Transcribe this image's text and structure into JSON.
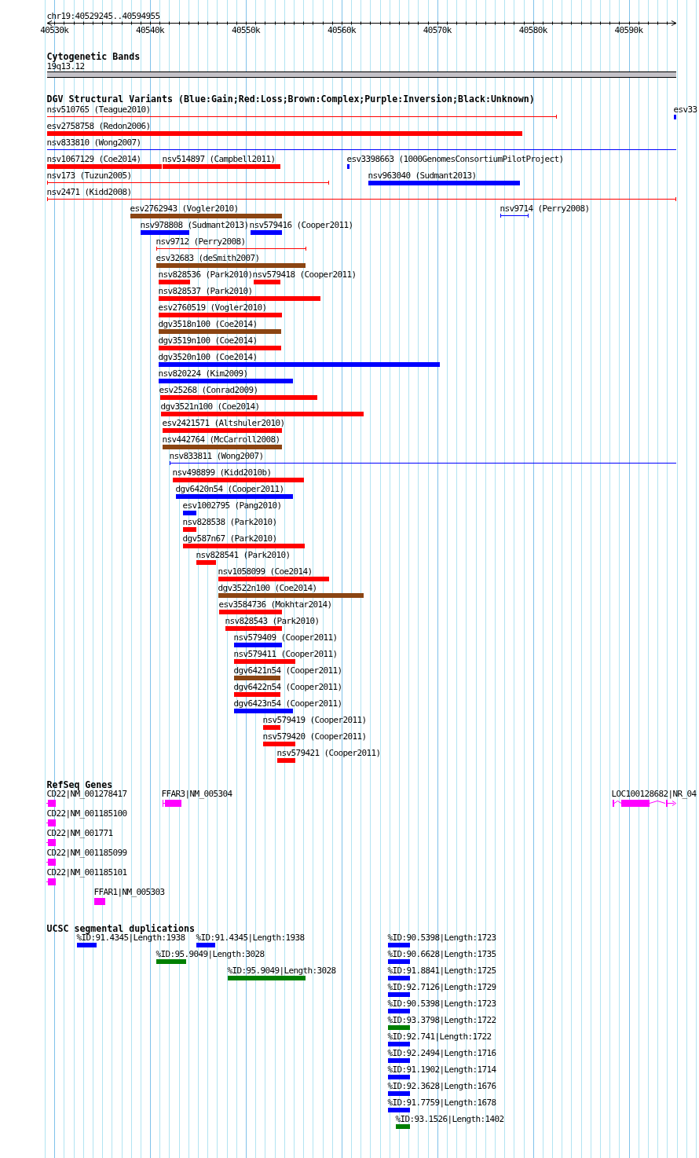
{
  "ruler": {
    "position": "chr19:40529245..40594955",
    "ticks": [
      "40530k",
      "40540k",
      "40550k",
      "40560k",
      "40570k",
      "40580k",
      "40590k"
    ]
  },
  "cytogenetic_bands": {
    "title": "Cytogenetic Bands",
    "band": "19q13.12"
  },
  "dgv_structural_variants": {
    "title": "DGV Structural Variants (Blue:Gain;Red:Loss;Brown:Complex;Purple:Inversion;Black:Unknown)",
    "items": [
      {
        "label": "nsv510765 (Teague2010)",
        "kind": "line",
        "color": "#ff0000"
      },
      {
        "label": "esv33",
        "kind": "bar",
        "color": "#0000ff"
      },
      {
        "label": "esv2758758 (Redon2006)",
        "kind": "bar",
        "color": "#ff0000"
      },
      {
        "label": "nsv833810 (Wong2007)",
        "kind": "line",
        "color": "#0000ff"
      },
      {
        "label": "nsv1067129 (Coe2014)",
        "kind": "bar",
        "color": "#ff0000"
      },
      {
        "label": "nsv514897 (Campbell2011)",
        "kind": "bar",
        "color": "#ff0000"
      },
      {
        "label": "esv3398663 (1000GenomesConsortiumPilotProject)",
        "kind": "bar",
        "color": "#0000ff"
      },
      {
        "label": "nsv173 (Tuzun2005)",
        "kind": "line",
        "color": "#ff0000"
      },
      {
        "label": "nsv963040 (Sudmant2013)",
        "kind": "bar",
        "color": "#0000ff"
      },
      {
        "label": "nsv2471 (Kidd2008)",
        "kind": "line",
        "color": "#ff0000"
      },
      {
        "label": "esv2762943 (Vogler2010)",
        "kind": "bar",
        "color": "#8b4513"
      },
      {
        "label": "nsv9714 (Perry2008)",
        "kind": "line",
        "color": "#0000ff"
      },
      {
        "label": "nsv978808 (Sudmant2013)",
        "kind": "bar",
        "color": "#0000ff"
      },
      {
        "label": "nsv579416 (Cooper2011)",
        "kind": "bar",
        "color": "#0000ff"
      },
      {
        "label": "nsv9712 (Perry2008)",
        "kind": "line",
        "color": "#ff0000"
      },
      {
        "label": "esv32683 (deSmith2007)",
        "kind": "bar",
        "color": "#8b4513"
      },
      {
        "label": "nsv828536 (Park2010)",
        "kind": "bar",
        "color": "#ff0000"
      },
      {
        "label": "nsv579418 (Cooper2011)",
        "kind": "bar",
        "color": "#ff0000"
      },
      {
        "label": "nsv828537 (Park2010)",
        "kind": "bar",
        "color": "#ff0000"
      },
      {
        "label": "esv2760519 (Vogler2010)",
        "kind": "bar",
        "color": "#ff0000"
      },
      {
        "label": "dgv3518n100 (Coe2014)",
        "kind": "bar",
        "color": "#8b4513"
      },
      {
        "label": "dgv3519n100 (Coe2014)",
        "kind": "bar",
        "color": "#ff0000"
      },
      {
        "label": "dgv3520n100 (Coe2014)",
        "kind": "bar",
        "color": "#0000ff"
      },
      {
        "label": "nsv820224 (Kim2009)",
        "kind": "bar",
        "color": "#0000ff"
      },
      {
        "label": "esv25268 (Conrad2009)",
        "kind": "bar",
        "color": "#ff0000"
      },
      {
        "label": "dgv3521n100 (Coe2014)",
        "kind": "bar",
        "color": "#ff0000"
      },
      {
        "label": "esv2421571 (Altshuler2010)",
        "kind": "bar",
        "color": "#ff0000"
      },
      {
        "label": "nsv442764 (McCarroll2008)",
        "kind": "bar",
        "color": "#8b4513"
      },
      {
        "label": "nsv833811 (Wong2007)",
        "kind": "line",
        "color": "#0000ff"
      },
      {
        "label": "nsv498899 (Kidd2010b)",
        "kind": "bar",
        "color": "#ff0000"
      },
      {
        "label": "dgv6420n54 (Cooper2011)",
        "kind": "bar",
        "color": "#0000ff"
      },
      {
        "label": "esv1002795 (Pang2010)",
        "kind": "bar",
        "color": "#0000ff"
      },
      {
        "label": "nsv828538 (Park2010)",
        "kind": "bar",
        "color": "#ff0000"
      },
      {
        "label": "dgv587n67 (Park2010)",
        "kind": "bar",
        "color": "#ff0000"
      },
      {
        "label": "nsv828541 (Park2010)",
        "kind": "bar",
        "color": "#ff0000"
      },
      {
        "label": "nsv1058099 (Coe2014)",
        "kind": "bar",
        "color": "#ff0000"
      },
      {
        "label": "dgv3522n100 (Coe2014)",
        "kind": "bar",
        "color": "#8b4513"
      },
      {
        "label": "esv3584736 (Mokhtar2014)",
        "kind": "bar",
        "color": "#ff0000"
      },
      {
        "label": "nsv828543 (Park2010)",
        "kind": "bar",
        "color": "#ff0000"
      },
      {
        "label": "nsv579409 (Cooper2011)",
        "kind": "bar",
        "color": "#0000ff"
      },
      {
        "label": "nsv579411 (Cooper2011)",
        "kind": "bar",
        "color": "#ff0000"
      },
      {
        "label": "dgv6421n54 (Cooper2011)",
        "kind": "bar",
        "color": "#8b4513"
      },
      {
        "label": "dgv6422n54 (Cooper2011)",
        "kind": "bar",
        "color": "#ff0000"
      },
      {
        "label": "dgv6423n54 (Cooper2011)",
        "kind": "bar",
        "color": "#0000ff"
      },
      {
        "label": "nsv579419 (Cooper2011)",
        "kind": "bar",
        "color": "#ff0000"
      },
      {
        "label": "nsv579420 (Cooper2011)",
        "kind": "bar",
        "color": "#ff0000"
      },
      {
        "label": "nsv579421 (Cooper2011)",
        "kind": "bar",
        "color": "#ff0000"
      }
    ]
  },
  "refseq_genes": {
    "title": "RefSeq Genes",
    "items": [
      {
        "label": "CD22|NM_001278417"
      },
      {
        "label": "FFAR3|NM_005304"
      },
      {
        "label": "LOC100128682|NR_04"
      },
      {
        "label": "CD22|NM_001185100"
      },
      {
        "label": "CD22|NM_001771"
      },
      {
        "label": "CD22|NM_001185099"
      },
      {
        "label": "CD22|NM_001185101"
      },
      {
        "label": "FFAR1|NM_005303"
      }
    ]
  },
  "segmental_duplications": {
    "title": "UCSC segmental duplications",
    "items": [
      {
        "label": "%ID:91.4345|Length:1938",
        "color": "#0000ff"
      },
      {
        "label": "%ID:91.4345|Length:1938",
        "color": "#0000ff"
      },
      {
        "label": "%ID:90.5398|Length:1723",
        "color": "#0000ff"
      },
      {
        "label": "%ID:95.9049|Length:3028",
        "color": "#008000"
      },
      {
        "label": "%ID:90.6628|Length:1735",
        "color": "#0000ff"
      },
      {
        "label": "%ID:95.9049|Length:3028",
        "color": "#008000"
      },
      {
        "label": "%ID:91.8841|Length:1725",
        "color": "#0000ff"
      },
      {
        "label": "%ID:92.7126|Length:1729",
        "color": "#0000ff"
      },
      {
        "label": "%ID:90.5398|Length:1723",
        "color": "#0000ff"
      },
      {
        "label": "%ID:93.3798|Length:1722",
        "color": "#008000"
      },
      {
        "label": "%ID:92.741|Length:1722",
        "color": "#0000ff"
      },
      {
        "label": "%ID:92.2494|Length:1716",
        "color": "#0000ff"
      },
      {
        "label": "%ID:91.1902|Length:1714",
        "color": "#0000ff"
      },
      {
        "label": "%ID:92.3628|Length:1676",
        "color": "#0000ff"
      },
      {
        "label": "%ID:91.7759|Length:1678",
        "color": "#0000ff"
      },
      {
        "label": "%ID:93.1526|Length:1402",
        "color": "#008000"
      }
    ]
  }
}
